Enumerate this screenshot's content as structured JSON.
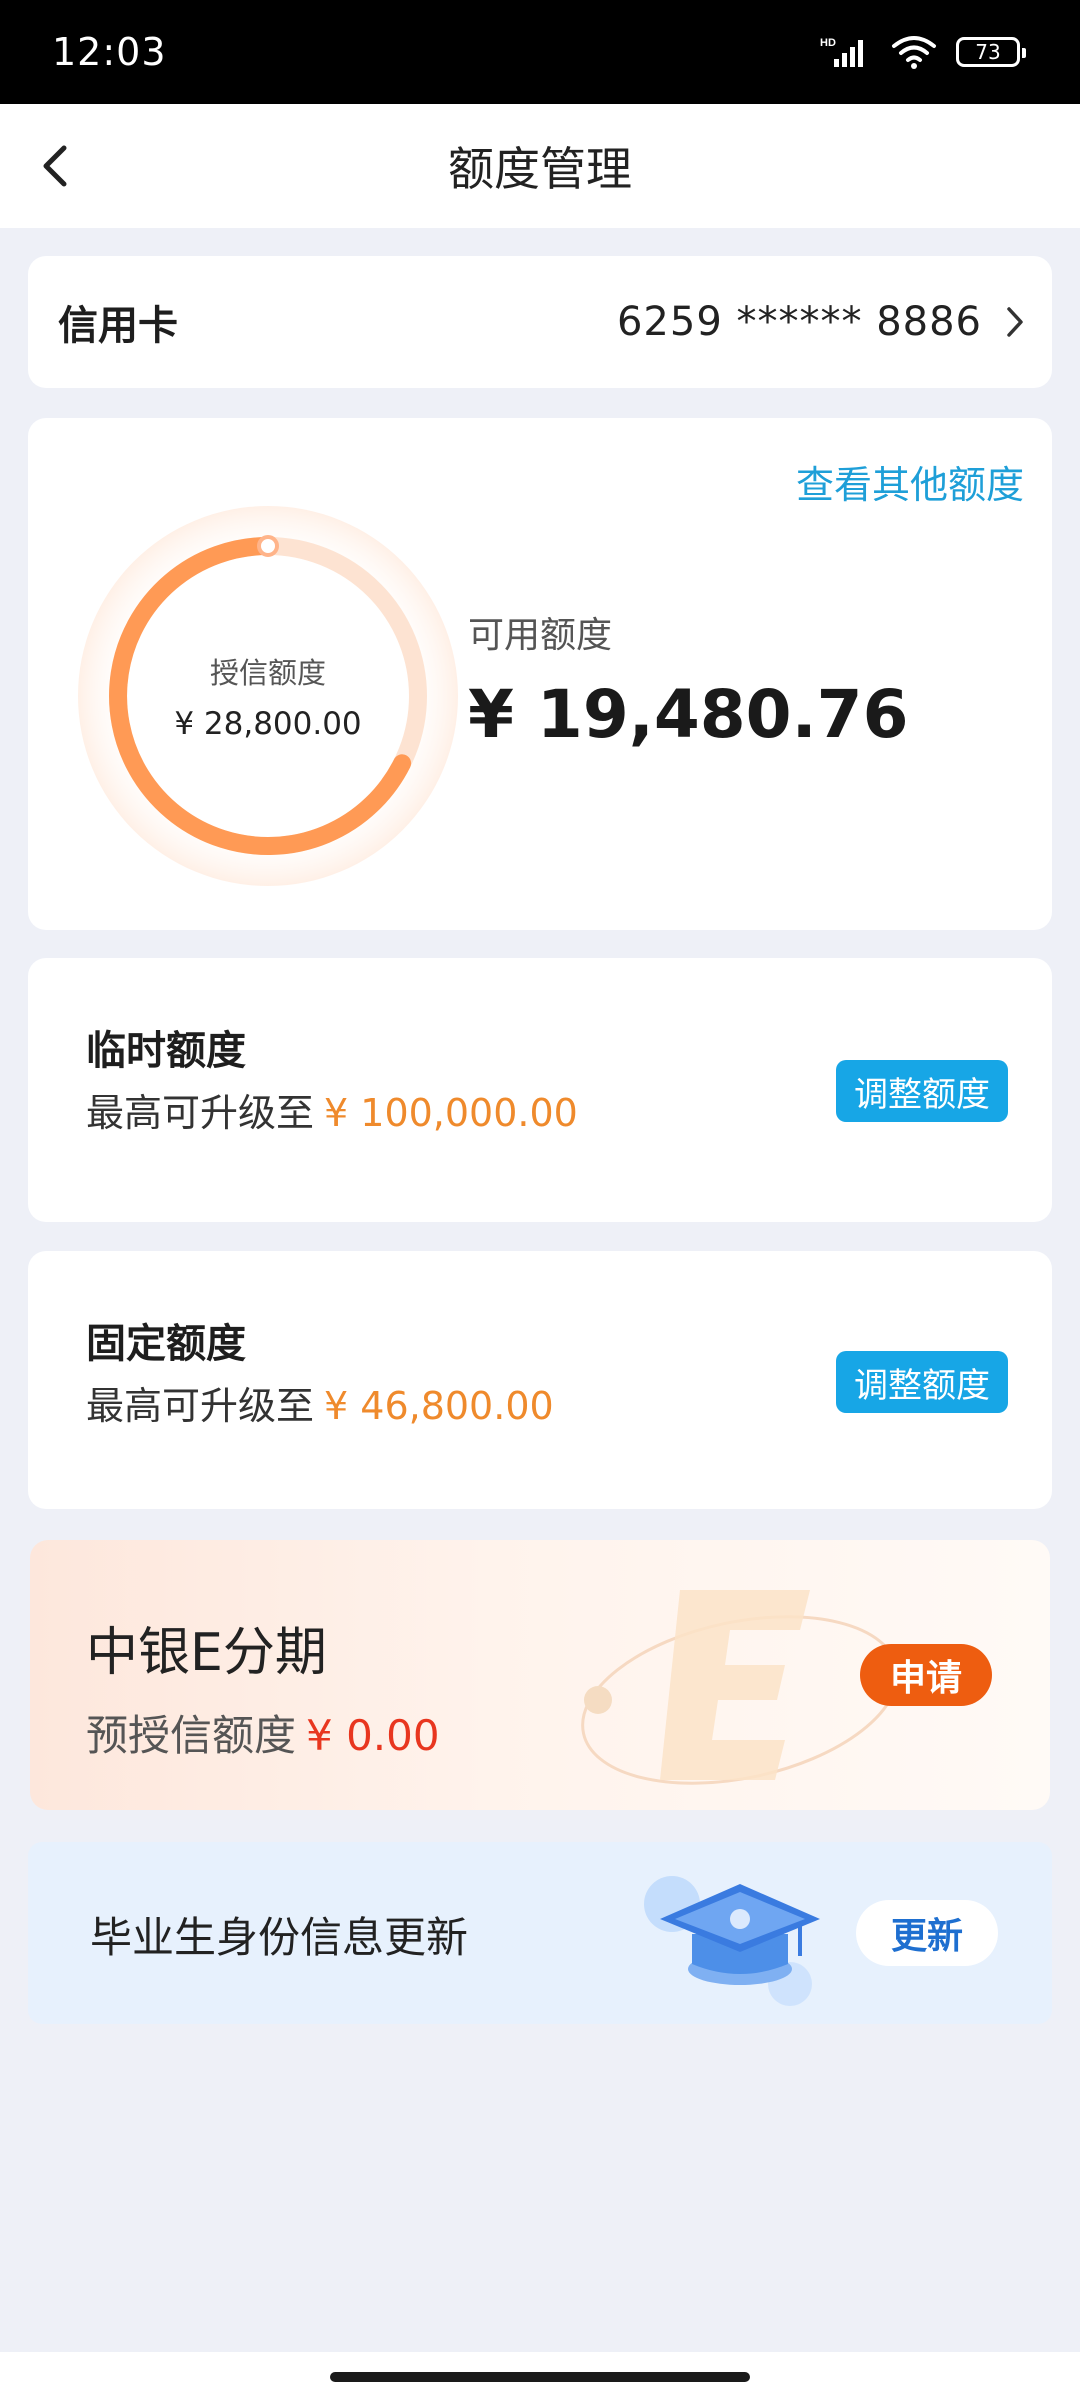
{
  "status_bar": {
    "time": "12:03",
    "battery": "73"
  },
  "header": {
    "title": "额度管理"
  },
  "card_row": {
    "label": "信用卡",
    "number": "6259 ****** 8886"
  },
  "limit_card": {
    "other_limits_link": "查看其他额度",
    "credit_label": "授信额度",
    "credit_value": "¥ 28,800.00",
    "available_label": "可用额度",
    "available_value": "¥ 19,480.76",
    "used_fraction": 0.324
  },
  "temp_limit": {
    "title": "临时额度",
    "sub_prefix": "最高可升级至",
    "amount": "¥ 100,000.00",
    "button": "调整额度"
  },
  "fixed_limit": {
    "title": "固定额度",
    "sub_prefix": "最高可升级至",
    "amount": "¥ 46,800.00",
    "button": "调整额度"
  },
  "installment": {
    "title": "中银E分期",
    "sub_prefix": "预授信额度",
    "amount": "¥ 0.00",
    "button": "申请"
  },
  "graduate": {
    "title": "毕业生身份信息更新",
    "button": "更新"
  },
  "colors": {
    "accent_blue": "#17a6e6",
    "amount_orange": "#ef8a2c",
    "ring_orange": "#ff9a55",
    "apply_orange": "#ee5d10",
    "amount_red": "#e8361f"
  }
}
